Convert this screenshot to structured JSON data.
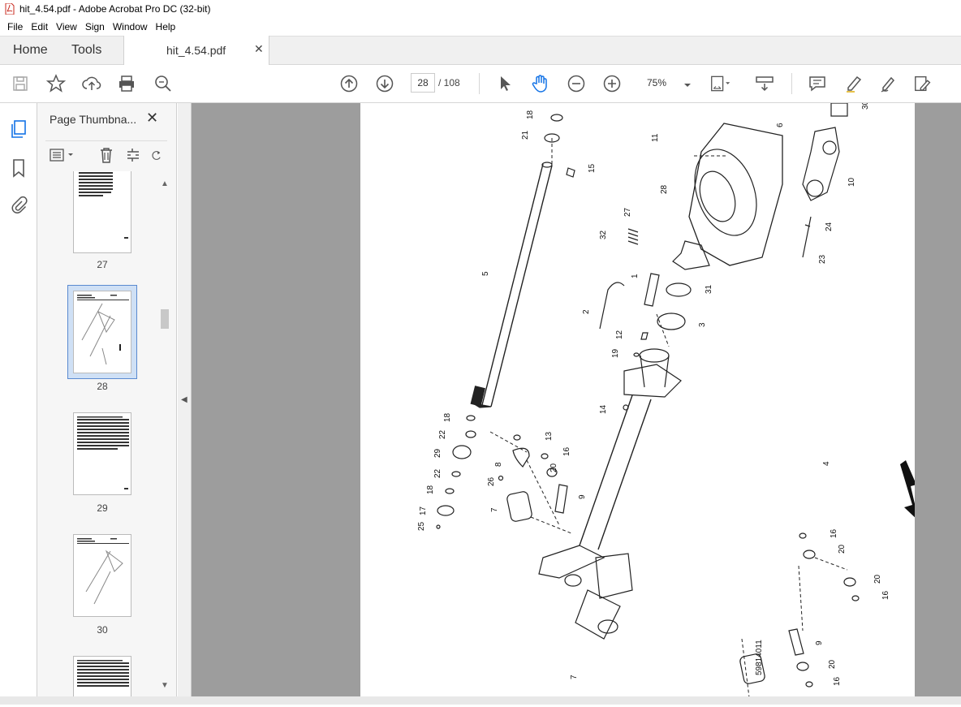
{
  "window": {
    "title": "hit_4.54.pdf - Adobe Acrobat Pro DC (32-bit)"
  },
  "menu": [
    "File",
    "Edit",
    "View",
    "Sign",
    "Window",
    "Help"
  ],
  "tabs": {
    "home": "Home",
    "tools": "Tools",
    "document": "hit_4.54.pdf"
  },
  "toolbar": {
    "current_page": "28",
    "page_total": "/  108",
    "zoom": "75%"
  },
  "panel": {
    "title": "Page Thumbna...",
    "thumbnails": [
      {
        "label": "27"
      },
      {
        "label": "28"
      },
      {
        "label": "29"
      },
      {
        "label": "30"
      },
      {
        "label": ""
      }
    ]
  },
  "drawing": {
    "drawing_number": "59814011",
    "callouts": [
      "18",
      "21",
      "15",
      "5",
      "11",
      "6",
      "30",
      "10",
      "28",
      "27",
      "32",
      "24",
      "23",
      "1",
      "31",
      "2",
      "3",
      "12",
      "19",
      "14",
      "18",
      "22",
      "13",
      "29",
      "16",
      "8",
      "20",
      "22",
      "26",
      "9",
      "18",
      "17",
      "7",
      "25",
      "4",
      "16",
      "20",
      "20",
      "16",
      "9",
      "20",
      "7",
      "16"
    ]
  },
  "colors": {
    "accent": "#1473e6",
    "viewer_bg": "#9d9d9d",
    "selection": "#cfe0f5"
  }
}
